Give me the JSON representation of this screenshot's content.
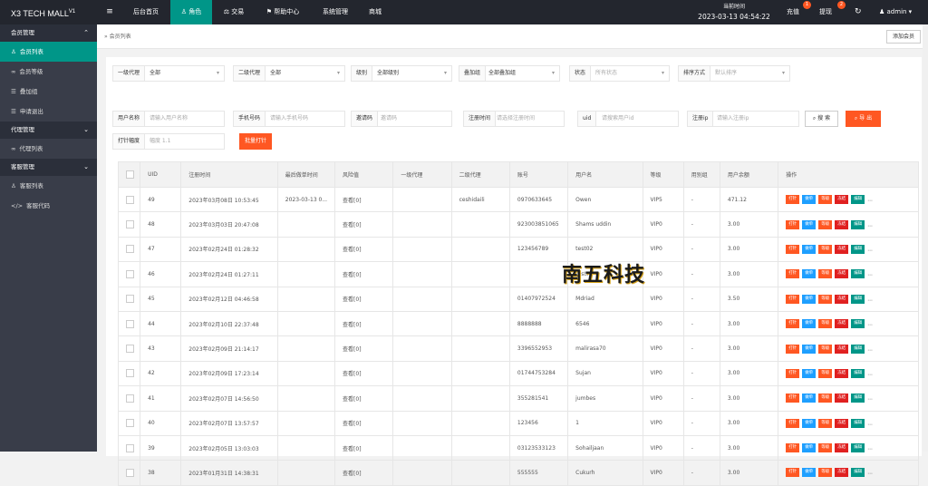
{
  "app": {
    "logo": "X3 TECH MALL",
    "logo_ver": "V1"
  },
  "nav": {
    "toggle": "≡",
    "items": [
      {
        "label": "后台首页"
      },
      {
        "label": "♙ 角色"
      },
      {
        "label": "⚖ 交易"
      },
      {
        "label": "⚑ 帮助中心"
      },
      {
        "label": "系统管理"
      },
      {
        "label": "商城"
      }
    ]
  },
  "clock": {
    "label": "当前时间",
    "time": "2023-03-13 04:54:22"
  },
  "top_right": {
    "recharge": "充值",
    "recharge_badge": "1",
    "withdraw": "提现",
    "withdraw_badge": "2",
    "refresh": "↻",
    "user": "admin"
  },
  "sidebar": {
    "g1": "会员管理",
    "i1": "会员列表",
    "i2": "会员等级",
    "i3": "叠加组",
    "i4": "申请退出",
    "g2": "代理管理",
    "i5": "代理列表",
    "g3": "客服管理",
    "i6": "客服列表",
    "i7": "客服代码"
  },
  "crumb": "会员列表",
  "add_member": "添加会员",
  "filters": {
    "agent1": {
      "label": "一级代理",
      "value": "全部"
    },
    "agent2": {
      "label": "二级代理",
      "value": "全部"
    },
    "level": {
      "label": "级别",
      "value": "全部级别"
    },
    "stack": {
      "label": "叠加组",
      "value": "全部叠加组"
    },
    "status": {
      "label": "状态",
      "placeholder": "所有状态"
    },
    "sort": {
      "label": "排序方式",
      "placeholder": "默认排序"
    },
    "username": {
      "label": "用户名称",
      "placeholder": "请输入用户名称"
    },
    "phone": {
      "label": "手机号码",
      "placeholder": "请输入手机号码"
    },
    "invite": {
      "label": "邀请码",
      "placeholder": "邀请码"
    },
    "regtime": {
      "label": "注册时间",
      "placeholder": "请选择注册时间"
    },
    "uid": {
      "label": "uid",
      "placeholder": "请搜索用户id"
    },
    "regip": {
      "label": "注册ip",
      "placeholder": "请输入注册ip"
    },
    "print": {
      "label": "打针幅度",
      "placeholder": "幅度 1.1"
    },
    "search_btn": "搜 索",
    "export_btn": "导 出",
    "batch_btn": "批量打针"
  },
  "table": {
    "headers": [
      "",
      "UID",
      "注册时间",
      "最后做单时间",
      "风险值",
      "一级代理",
      "二级代理",
      "账号",
      "用户名",
      "等级",
      "用别组",
      "用户余额",
      "操作"
    ],
    "rows": [
      [
        "49",
        "2023年03月08日 10:53:45",
        "2023-03-13 0...",
        "查看[0]",
        "",
        "ceshidaili",
        "0970633645",
        "Owen",
        "VIP5",
        "-",
        "471.12"
      ],
      [
        "48",
        "2023年03月03日 20:47:08",
        "",
        "查看[0]",
        "",
        "",
        "923003851065",
        "Shams uddin",
        "VIP0",
        "-",
        "3.00"
      ],
      [
        "47",
        "2023年02月24日 01:28:32",
        "",
        "查看[0]",
        "",
        "",
        "123456789",
        "test02",
        "VIP0",
        "-",
        "3.00"
      ],
      [
        "46",
        "2023年02月24日 01:27:11",
        "",
        "查看[0]",
        "",
        "",
        "",
        "test01",
        "VIP0",
        "-",
        "3.00"
      ],
      [
        "45",
        "2023年02月12日 04:46:58",
        "",
        "查看[0]",
        "",
        "",
        "01407972524",
        "Mdriad",
        "VIP0",
        "-",
        "3.50"
      ],
      [
        "44",
        "2023年02月10日 22:37:48",
        "",
        "查看[0]",
        "",
        "",
        "8888888",
        "6546",
        "VIP0",
        "-",
        "3.00"
      ],
      [
        "43",
        "2023年02月09日 21:14:17",
        "",
        "查看[0]",
        "",
        "",
        "3396552953",
        "malirasa70",
        "VIP0",
        "-",
        "3.00"
      ],
      [
        "42",
        "2023年02月09日 17:23:14",
        "",
        "查看[0]",
        "",
        "",
        "01744753284",
        "Sujan",
        "VIP0",
        "-",
        "3.00"
      ],
      [
        "41",
        "2023年02月07日 14:56:50",
        "",
        "查看[0]",
        "",
        "",
        "355281541",
        "jumbes",
        "VIP0",
        "-",
        "3.00"
      ],
      [
        "40",
        "2023年02月07日 13:57:57",
        "",
        "查看[0]",
        "",
        "",
        "123456",
        "1",
        "VIP0",
        "-",
        "3.00"
      ],
      [
        "39",
        "2023年02月05日 13:03:03",
        "",
        "查看[0]",
        "",
        "",
        "03123533123",
        "Sohailjaan",
        "VIP0",
        "-",
        "3.00"
      ],
      [
        "38",
        "2023年01月31日 14:38:31",
        "",
        "查看[0]",
        "",
        "",
        "555555",
        "Cukurh",
        "VIP0",
        "-",
        "3.00"
      ]
    ],
    "ops": [
      "打针",
      "做单",
      "等级",
      "冻结",
      "编辑",
      "..."
    ]
  },
  "watermark": "南五科技"
}
